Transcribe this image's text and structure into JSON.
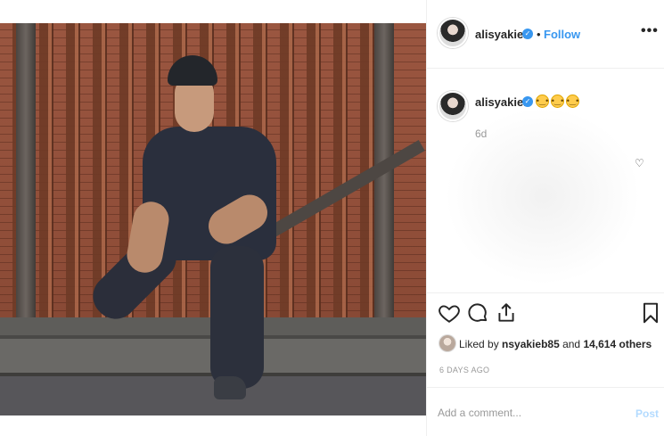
{
  "post": {
    "username": "alisyakieb",
    "follow_label": "Follow",
    "separator": "•",
    "more_label": "•••",
    "caption_emojis": [
      "😳",
      "😳",
      "😳"
    ],
    "age": "6d",
    "liked_by_prefix": "Liked by ",
    "liked_by_user": "nsyakieb85",
    "liked_by_and": " and ",
    "liked_by_count": "14,614 others",
    "timestamp": "6 DAYS AGO",
    "comment_placeholder": "Add a comment...",
    "post_label": "Post"
  },
  "icons": {
    "verified": "verified-badge-icon",
    "like": "heart-icon",
    "comment": "comment-icon",
    "share": "share-icon",
    "save": "bookmark-icon",
    "comment_like": "small-heart-icon"
  },
  "colors": {
    "accent": "#3897f0",
    "post_disabled": "#b3dbff",
    "muted": "#999999"
  }
}
